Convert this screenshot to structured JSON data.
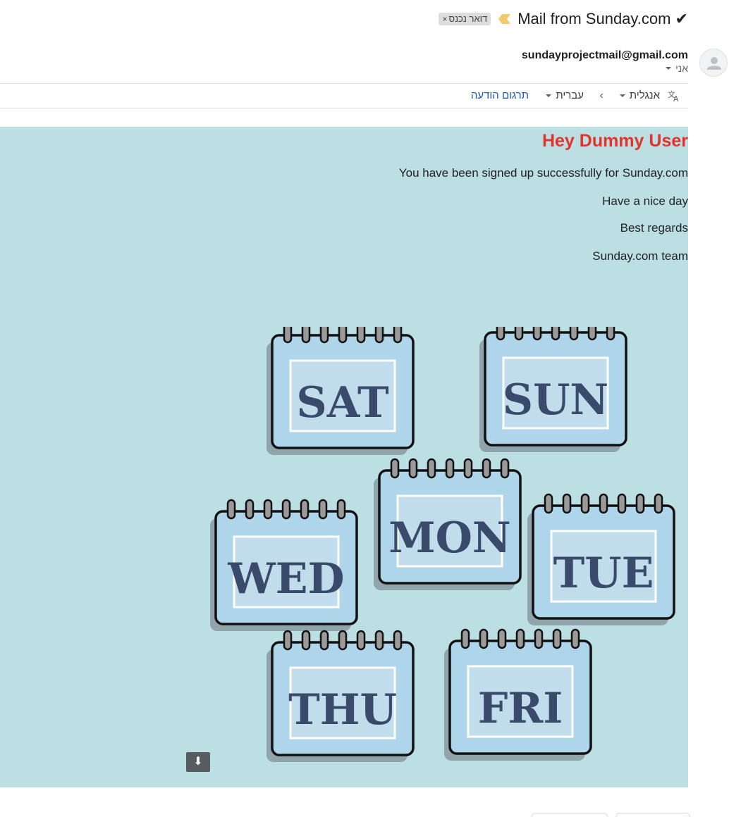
{
  "email": {
    "subject": "Mail from Sunday.com ✔",
    "label_chip": "דואר נכנס",
    "label_close": "×",
    "sender_email": "sundayprojectmail@gmail.com",
    "recipient": "אני"
  },
  "translate_bar": {
    "from_language": "אנגלית",
    "to_language": "עברית",
    "translate_link": "תרגום הודעה"
  },
  "body": {
    "greeting": "Hey Dummy User",
    "lines": [
      "You have been signed up successfully for Sunday.com",
      "Have a nice day",
      "Best regards",
      "Sunday.com team"
    ],
    "image": {
      "days": [
        "SAT",
        "SUN",
        "MON",
        "WED",
        "TUE",
        "THU",
        "FRI"
      ],
      "download_glyph": "⬇"
    }
  },
  "colors": {
    "body_bg": "#bcdfe4",
    "greeting": "#e3332a",
    "link": "#1a56c4",
    "calendar_fill": "#aed5ea",
    "calendar_panel": "#c1dcea",
    "calendar_text": "#3a4a6b"
  }
}
